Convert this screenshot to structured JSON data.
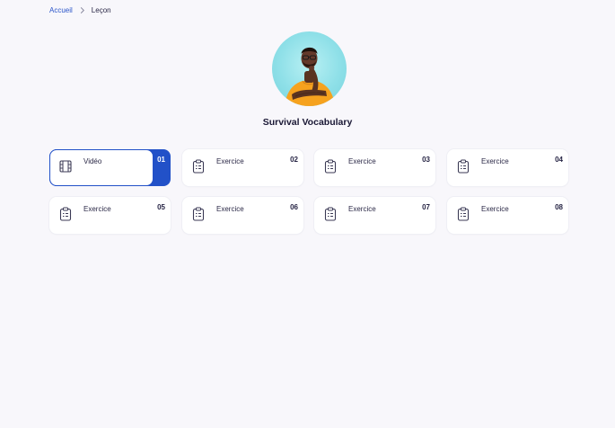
{
  "breadcrumb": {
    "home": "Accueil",
    "current": "Leçon"
  },
  "course": {
    "title": "Survival Vocabulary"
  },
  "lessons": [
    {
      "label": "Vidéo",
      "number": "01",
      "icon": "film-icon",
      "active": true
    },
    {
      "label": "Exercice",
      "number": "02",
      "icon": "clipboard-icon",
      "active": false
    },
    {
      "label": "Exercice",
      "number": "03",
      "icon": "clipboard-icon",
      "active": false
    },
    {
      "label": "Exercice",
      "number": "04",
      "icon": "clipboard-icon",
      "active": false
    },
    {
      "label": "Exercice",
      "number": "05",
      "icon": "clipboard-icon",
      "active": false
    },
    {
      "label": "Exercice",
      "number": "06",
      "icon": "clipboard-icon",
      "active": false
    },
    {
      "label": "Exercice",
      "number": "07",
      "icon": "clipboard-icon",
      "active": false
    },
    {
      "label": "Exercice",
      "number": "08",
      "icon": "clipboard-icon",
      "active": false
    }
  ],
  "colors": {
    "accent": "#2251c8",
    "link": "#2b55c9",
    "background": "#f8f7fb"
  }
}
